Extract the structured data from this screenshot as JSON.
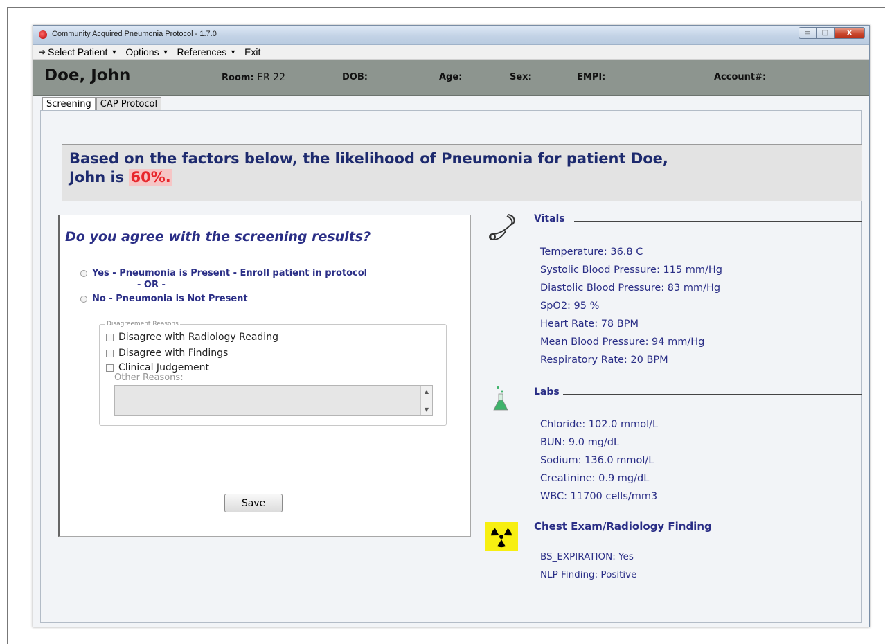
{
  "window": {
    "title": "Community Acquired Pneumonia Protocol  - 1.7.0",
    "controls": {
      "minimize": "▭",
      "maximize": "□",
      "close": "X"
    }
  },
  "menu": {
    "items": [
      "Select Patient",
      "Options",
      "References",
      "Exit"
    ]
  },
  "patient": {
    "name": "Doe, John",
    "room_label": "Room:",
    "room_value": "ER 22",
    "dob_label": "DOB:",
    "age_label": "Age:",
    "sex_label": "Sex:",
    "empi_label": "EMPI:",
    "account_label": "Account#:"
  },
  "tabs": [
    "Screening",
    "CAP Protocol"
  ],
  "banner": {
    "prefix": "Based on the factors below, the likelihood of Pneumonia for patient Doe, John is ",
    "percent": "60%."
  },
  "screening": {
    "question": "Do you agree with the screening results?",
    "option_yes": "Yes - Pneumonia is Present - Enroll patient in protocol",
    "or_text": "- OR -",
    "option_no": "No - Pneumonia is Not Present",
    "reasons_legend": "Disagreement Reasons",
    "reasons": [
      "Disagree with Radiology Reading",
      "Disagree with Findings",
      "Clinical Judgement"
    ],
    "other_label": "Other Reasons:",
    "save_label": "Save"
  },
  "vitals": {
    "title": "Vitals",
    "items": [
      "Temperature:  36.8 C",
      "Systolic Blood Pressure:  115 mm/Hg",
      "Diastolic Blood Pressure:  83 mm/Hg",
      "SpO2:  95 %",
      "Heart Rate:  78 BPM",
      "Mean Blood Pressure:  94 mm/Hg",
      "Respiratory Rate:  20 BPM"
    ]
  },
  "labs": {
    "title": "Labs",
    "items": [
      "Chloride:  102.0 mmol/L",
      "BUN:  9.0 mg/dL",
      "Sodium:  136.0 mmol/L",
      "Creatinine:  0.9 mg/dL",
      "WBC:  11700 cells/mm3"
    ]
  },
  "chest": {
    "title": "Chest Exam/Radiology Finding",
    "items": [
      "BS_EXPIRATION:  Yes",
      "NLP Finding:  Positive"
    ]
  }
}
